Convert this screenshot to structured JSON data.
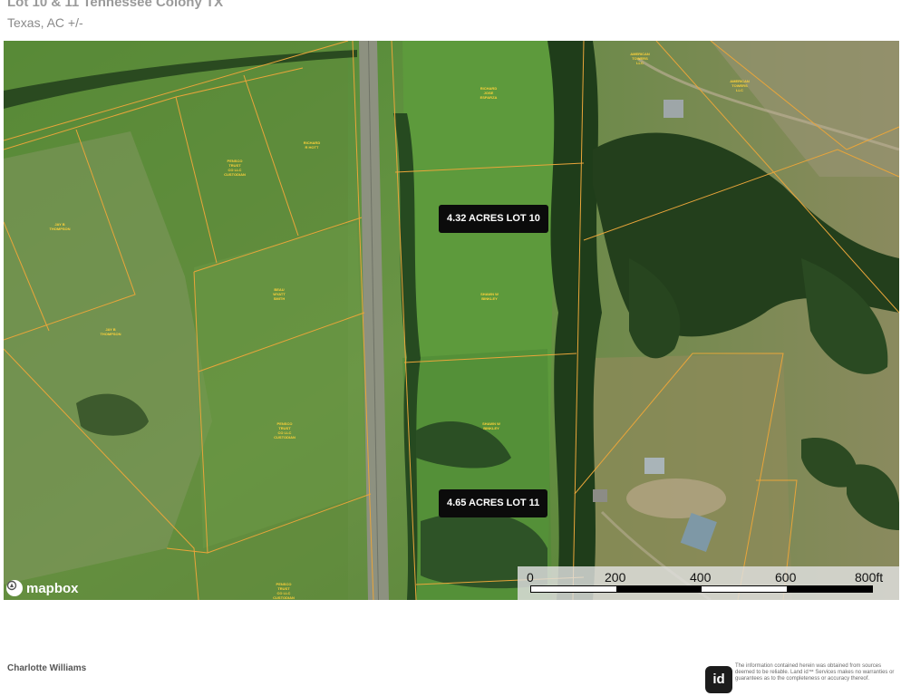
{
  "header": {
    "title": "Lot 10 & 11 Tennessee Colony TX",
    "subtitle": "Texas, AC +/-"
  },
  "map": {
    "lots": [
      {
        "label": "4.32 ACRES LOT 10"
      },
      {
        "label": "4.65 ACRES LOT 11"
      }
    ],
    "owners": [
      "RICHARD\nJOSE\nESPARZA",
      "AMERICAN\nTOWERS\nLLC",
      "AMERICAN\nTOWERS\nLLC",
      "RICHARD\nR HOTT",
      "PENSCO\nTRUST\nCO LLC\nCUSTODIAN",
      "JAY B\nTHOMPSON",
      "BEAU\nWYATT\nSMITH",
      "JAY B\nTHOMPSON",
      "SHAWN W\nBINKLEY",
      "SHAWN W\nBINKLEY",
      "PENSCO\nTRUST\nCO LLC\nCUSTODIAN",
      "PENSCO\nTRUST\nCO LLC\nCUSTODIAN"
    ],
    "attribution": "mapbox",
    "scale": {
      "ticks": [
        "0",
        "200",
        "400",
        "600",
        "800ft"
      ]
    },
    "colors": {
      "parcel_line": "#e9a53a",
      "owner_text": "#ffd23a",
      "label_bg": "#0b0b0b"
    }
  },
  "footer": {
    "agent_name": "Charlotte Williams",
    "brand_logo": "id",
    "disclaimer": "The information contained herein was obtained from sources deemed to be reliable. Land id™ Services makes no warranties or guarantees as to the completeness or accuracy thereof."
  }
}
